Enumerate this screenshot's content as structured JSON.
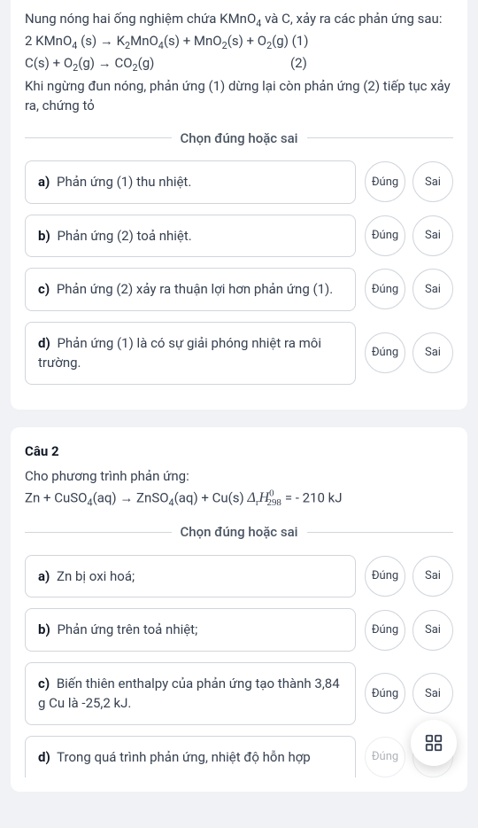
{
  "ui": {
    "divider_label": "Chọn đúng hoặc sai",
    "true_label": "Đúng",
    "false_label": "Sai"
  },
  "q1": {
    "intro_1": "Nung nóng hai ống nghiệm chứa KMnO",
    "intro_1_sub": "4",
    "intro_1b": " và C, xảy ra các phản ứng sau:",
    "eq1_a": "2 KMnO",
    "eq1_a_sub": "4",
    "eq1_b": " (s) → K",
    "eq1_b_sub": "2",
    "eq1_c": "MnO",
    "eq1_c_sub": "4",
    "eq1_d": "(s) + MnO",
    "eq1_d_sub": "2",
    "eq1_e": "(s) + O",
    "eq1_e_sub": "2",
    "eq1_f": "(g) (1)",
    "eq2_a": "C(s) + O",
    "eq2_a_sub": "2",
    "eq2_b": "(g) → CO",
    "eq2_b_sub": "2",
    "eq2_c": "(g)",
    "eq2_num": "(2)",
    "after": "Khi ngừng đun nóng, phản ứng (1) dừng lại còn phản ứng (2) tiếp tục xảy ra, chứng tỏ",
    "opts": {
      "a_label": "a)",
      "a_text": " Phản ứng (1) thu nhiệt.",
      "b_label": "b)",
      "b_text": " Phản ứng (2) toả nhiệt.",
      "c_label": "c)",
      "c_text": " Phản ứng (2) xảy ra thuận lợi hơn phản ứng (1).",
      "d_label": "d)",
      "d_text": " Phản ứng (1) là có sự giải phóng nhiệt ra môi trường."
    }
  },
  "q2": {
    "title": "Câu 2",
    "intro": "Cho phương trình phản ứng:",
    "eq_a": "Zn + CuSO",
    "eq_a_sub": "4",
    "eq_b": "(aq) → ZnSO",
    "eq_b_sub": "4",
    "eq_c": "(aq) + Cu(s)  ",
    "enth_delta": "Δ",
    "enth_r": "r",
    "enth_H": "H",
    "enth_sup": "0",
    "enth_sub": "298",
    "enth_val": " = - 210 kJ",
    "opts": {
      "a_label": "a)",
      "a_text": " Zn bị oxi hoá;",
      "b_label": "b)",
      "b_text": " Phản ứng trên toả nhiệt;",
      "c_label": "c)",
      "c_text": " Biến thiên enthalpy của phản ứng tạo thành 3,84 g Cu là -25,2 kJ.",
      "d_label": "d)",
      "d_text": " Trong quá trình phản ứng, nhiệt độ hỗn hợp"
    }
  }
}
